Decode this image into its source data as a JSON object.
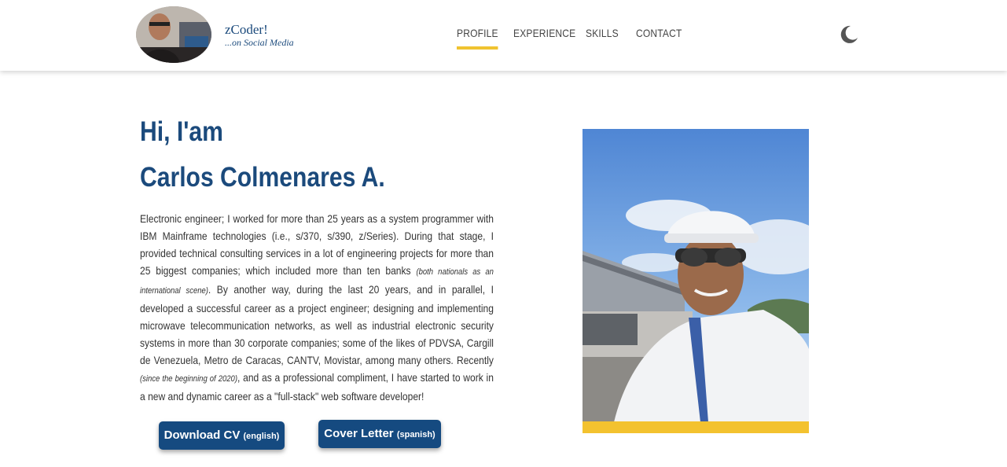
{
  "brand": {
    "title": "zCoder!",
    "subtitle": "...on Social Media"
  },
  "nav": {
    "items": [
      {
        "label": "PROFILE",
        "active": true
      },
      {
        "label": "EXPERIENCE",
        "active": false
      },
      {
        "label": "SKILLS",
        "active": false
      },
      {
        "label": "CONTACT",
        "active": false
      }
    ],
    "theme_toggle_icon": "moon-icon"
  },
  "hero": {
    "greeting": "Hi, I'am",
    "name": "Carlos Colmenares A.",
    "bio": {
      "part1": "Electronic engineer; I worked for more than 25 years as a system programmer with IBM Mainframe technologies (i.e., s/370, s/390, z/Series). During that stage, I provided technical consulting services in a lot of engineering projects for more than 25 biggest companies; which included more than ten banks ",
      "note1": "(both nationals as an international scene)",
      "part2": ". By another way, during the last 20 years, and in parallel, I developed a successful career as a project engineer; designing and implementing microwave telecommunication networks, as well as industrial electronic security systems in more than 30 corporate companies; some of the likes of PDVSA, Cargill de Venezuela, Metro de Caracas, CANTV, Movistar, among many others. Recently ",
      "note2": "(since the beginning of 2020)",
      "part3": ", and as a professional compliment, I have started to work in a new and dynamic career as a \"full-stack\" web software developer!"
    },
    "buttons": {
      "cv_label": "Download CV",
      "cv_note": "(english)",
      "cover_label": "Cover Letter",
      "cover_note": "(spanish)"
    }
  },
  "colors": {
    "primary": "#154a80",
    "accent": "#f3c22f",
    "text": "#333333"
  }
}
